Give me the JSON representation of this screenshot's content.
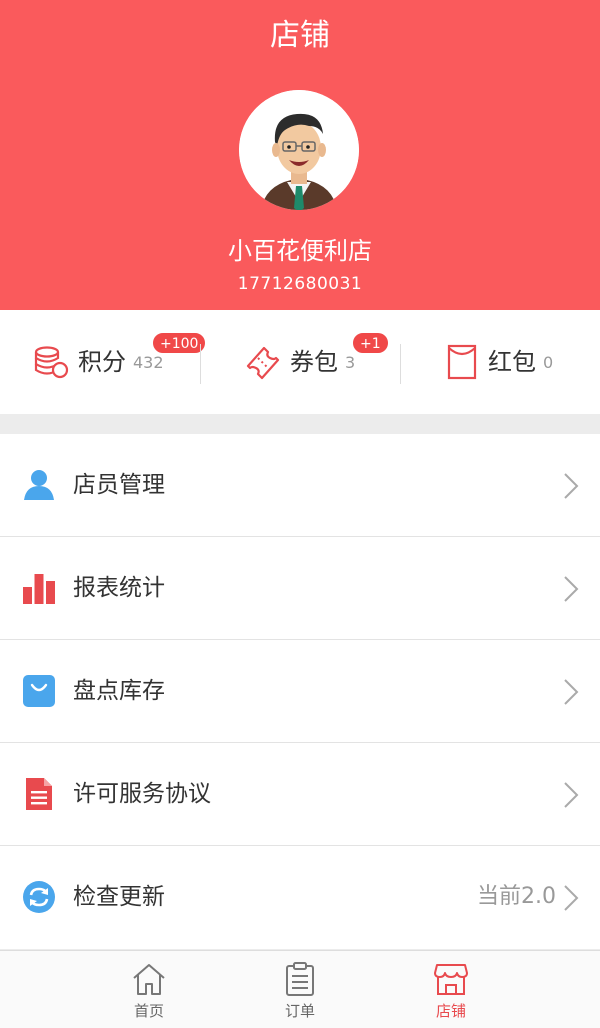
{
  "header": {
    "title": "店铺",
    "store_name": "小百花便利店",
    "phone": "17712680031"
  },
  "stats": [
    {
      "label": "积分",
      "count": "432",
      "badge": "+100",
      "icon": "coins-icon"
    },
    {
      "label": "券包",
      "count": "3",
      "badge": "+1",
      "icon": "coupon-icon"
    },
    {
      "label": "红包",
      "count": "0",
      "badge": "",
      "icon": "red-envelope-icon"
    }
  ],
  "menu": [
    {
      "label": "店员管理",
      "extra": "",
      "icon": "user-icon"
    },
    {
      "label": "报表统计",
      "extra": "",
      "icon": "bar-chart-icon"
    },
    {
      "label": "盘点库存",
      "extra": "",
      "icon": "bag-icon"
    },
    {
      "label": "许可服务协议",
      "extra": "",
      "icon": "document-icon"
    },
    {
      "label": "检查更新",
      "extra": "当前2.0",
      "icon": "refresh-icon"
    }
  ],
  "tabs": [
    {
      "label": "首页",
      "icon": "home-icon",
      "active": false
    },
    {
      "label": "订单",
      "icon": "clipboard-icon",
      "active": false
    },
    {
      "label": "店铺",
      "icon": "store-icon",
      "active": true
    }
  ],
  "colors": {
    "brand": "#fa5a5c",
    "badge": "#f04848",
    "active_tab": "#e84a4e",
    "icon_blue": "#4aa6ec",
    "icon_red": "#e84a4e"
  }
}
